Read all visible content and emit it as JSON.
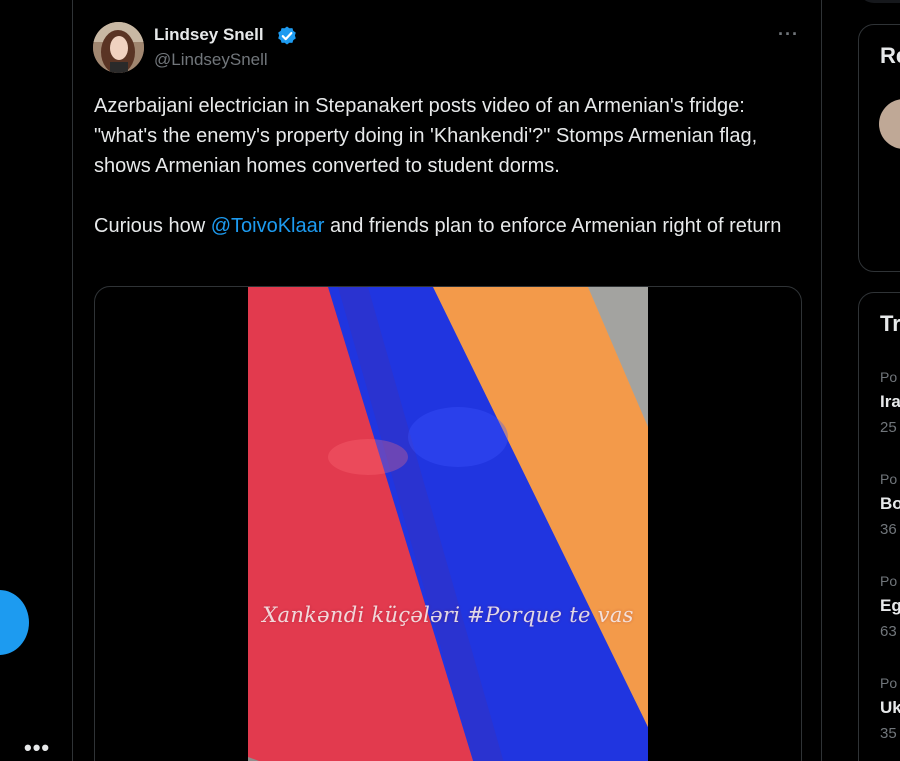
{
  "tweet": {
    "display_name": "Lindsey Snell",
    "handle": "@LindseySnell",
    "more_label": "···",
    "text_line1_before": "Azerbaijani electrician in Stepanakert posts video of an Armenian's fridge: \"what's the enemy's property doing in 'Khankendi'?\" Stomps Armenian flag, shows Armenian homes converted to student dorms.",
    "text_p2_before": "Curious how ",
    "mention": "@ToivoKlaar",
    "text_p2_after": " and friends plan to enforce Armenian right of return",
    "video_caption": "Xankəndi küçələri #Porque te vas"
  },
  "left_rail": {
    "more_label": "•••"
  },
  "right_sidebar": {
    "card1_title": "Re",
    "card2_title": "Tr",
    "trends": [
      {
        "cat": "Po",
        "name": "Ira",
        "count": "25"
      },
      {
        "cat": "Po",
        "name": "Bo",
        "count": "36"
      },
      {
        "cat": "Po",
        "name": "Eg",
        "count": "63"
      },
      {
        "cat": "Po",
        "name": "Uk",
        "count": "35"
      }
    ]
  },
  "colors": {
    "accent": "#1d9bf0",
    "flag_red": "#e23a4e",
    "flag_blue": "#2035e0",
    "flag_orange": "#f39a4a"
  },
  "icons": {
    "verified": "verified-badge-icon",
    "more": "more-horizontal-icon"
  }
}
